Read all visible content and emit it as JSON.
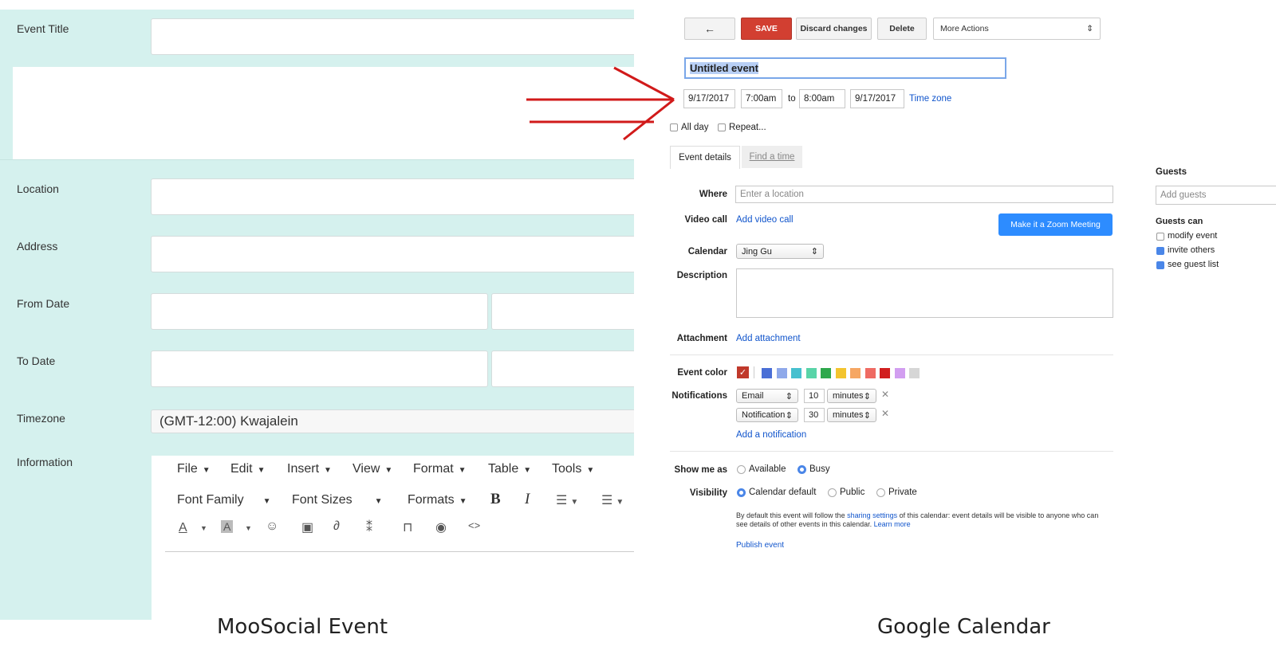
{
  "moosocial": {
    "caption": "MooSocial Event",
    "labels": {
      "event_title": "Event Title",
      "location": "Location",
      "address": "Address",
      "from_date": "From Date",
      "to_date": "To Date",
      "timezone": "Timezone",
      "information": "Information"
    },
    "timezone_value": "(GMT-12:00) Kwajalein",
    "editor": {
      "menu": [
        "File",
        "Edit",
        "Insert",
        "View",
        "Format",
        "Table",
        "Tools"
      ],
      "toolbar": {
        "font_family": "Font Family",
        "font_sizes": "Font Sizes",
        "formats": "Formats",
        "bold": "B",
        "italic": "I"
      }
    }
  },
  "gcal": {
    "caption": "Google Calendar",
    "toolbar": {
      "back": "←",
      "save": "SAVE",
      "discard": "Discard changes",
      "delete": "Delete",
      "more_actions": "More Actions"
    },
    "title_value": "Untitled event",
    "start_date": "9/17/2017",
    "start_time": "7:00am",
    "to": "to",
    "end_time": "8:00am",
    "end_date": "9/17/2017",
    "time_zone": "Time zone",
    "all_day": "All day",
    "repeat": "Repeat...",
    "tabs": [
      "Event details",
      "Find a time"
    ],
    "where_label": "Where",
    "where_placeholder": "Enter a location",
    "video_label": "Video call",
    "video_link": "Add video call",
    "zoom_button": "Make it a Zoom Meeting",
    "calendar_label": "Calendar",
    "calendar_value": "Jing Gu",
    "description_label": "Description",
    "attachment_label": "Attachment",
    "attachment_link": "Add attachment",
    "event_color_label": "Event color",
    "event_colors": [
      "#4a6fd6",
      "#8fa9ea",
      "#46c0cf",
      "#59d4a8",
      "#2ea84c",
      "#f3c42e",
      "#f6a763",
      "#ef6b63",
      "#d11f1f",
      "#d29ef0",
      "#d6d6d6"
    ],
    "selected_color": "#c0392b",
    "notifications_label": "Notifications",
    "notifications": [
      {
        "method": "Email",
        "value": "10",
        "unit": "minutes"
      },
      {
        "method": "Notification",
        "value": "30",
        "unit": "minutes"
      }
    ],
    "add_notification": "Add a notification",
    "show_me_as_label": "Show me as",
    "show_options": [
      "Available",
      "Busy"
    ],
    "show_selected": "Busy",
    "visibility_label": "Visibility",
    "visibility_options": [
      "Calendar default",
      "Public",
      "Private"
    ],
    "visibility_selected": "Calendar default",
    "visibility_note_1": "By default this event will follow the",
    "visibility_note_link": "sharing settings",
    "visibility_note_2": "of this calendar: event details will be visible to anyone",
    "visibility_note_3": "who can see details of other events in this calendar.",
    "learn_more": "Learn more",
    "publish_event": "Publish event",
    "guests_title": "Guests",
    "guests_placeholder": "Add guests",
    "guests_can": "Guests can",
    "guest_permissions": [
      {
        "label": "modify event",
        "checked": false
      },
      {
        "label": "invite others",
        "checked": true
      },
      {
        "label": "see guest list",
        "checked": true
      }
    ]
  }
}
